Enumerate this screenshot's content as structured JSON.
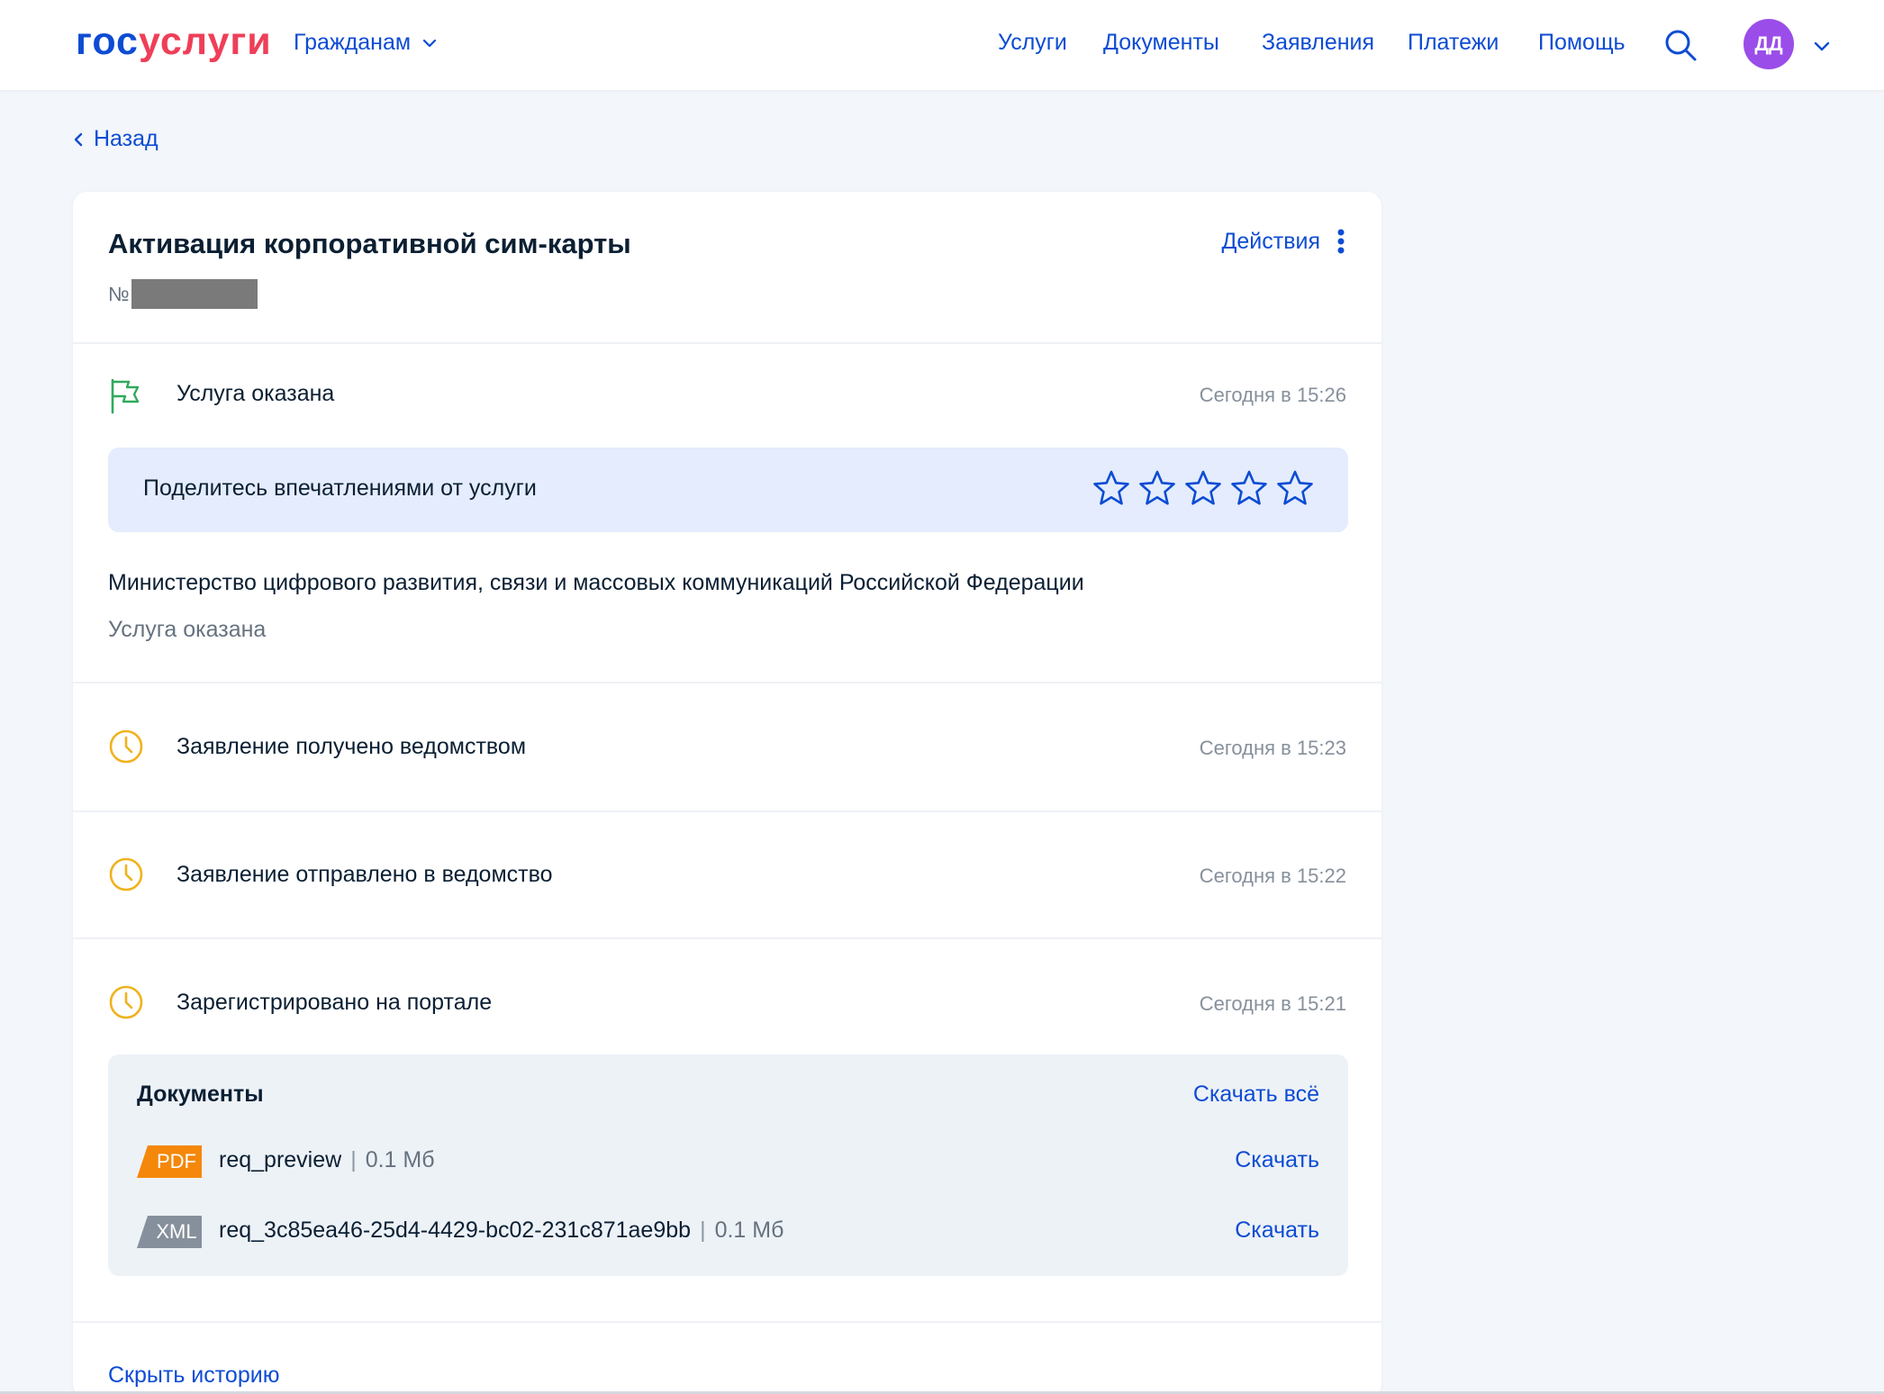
{
  "header": {
    "logo_part1": "гос",
    "logo_part2": "услуги",
    "region": "Гражданам",
    "nav": [
      "Услуги",
      "Документы",
      "Заявления",
      "Платежи",
      "Помощь"
    ],
    "avatar_initials": "ДД",
    "colors": {
      "brand_blue": "#0d4cd3",
      "brand_red": "#ee3f58",
      "avatar": "#9a4de8"
    }
  },
  "back_label": "Назад",
  "order": {
    "title": "Активация корпоративной сим-карты",
    "number_prefix": "№",
    "actions_label": "Действия"
  },
  "events": [
    {
      "icon": "flag-icon",
      "label": "Услуга оказана",
      "time": "Сегодня в 15:26"
    },
    {
      "icon": "clock-icon",
      "label": "Заявление получено ведомством",
      "time": "Сегодня в 15:23"
    },
    {
      "icon": "clock-icon",
      "label": "Заявление отправлено в ведомство",
      "time": "Сегодня в 15:22"
    },
    {
      "icon": "clock-icon",
      "label": "Зарегистрировано на портале",
      "time": "Сегодня в 15:21"
    }
  ],
  "rating": {
    "prompt": "Поделитесь впечатлениями от услуги",
    "max_stars": 5,
    "selected": 0
  },
  "organization": {
    "name": "Министерство цифрового развития, связи и массовых коммуникаций Российской Федерации",
    "status": "Услуга оказана"
  },
  "documents": {
    "title": "Документы",
    "download_all": "Скачать всё",
    "items": [
      {
        "type": "PDF",
        "color": "#f5870a",
        "name": "req_preview",
        "size": "0.1 Мб",
        "action": "Скачать"
      },
      {
        "type": "XML",
        "color": "#86909c",
        "name": "req_3c85ea46-25d4-4429-bc02-231c871ae9bb",
        "size": "0.1 Мб",
        "action": "Скачать"
      }
    ]
  },
  "hide_history": "Скрыть историю"
}
